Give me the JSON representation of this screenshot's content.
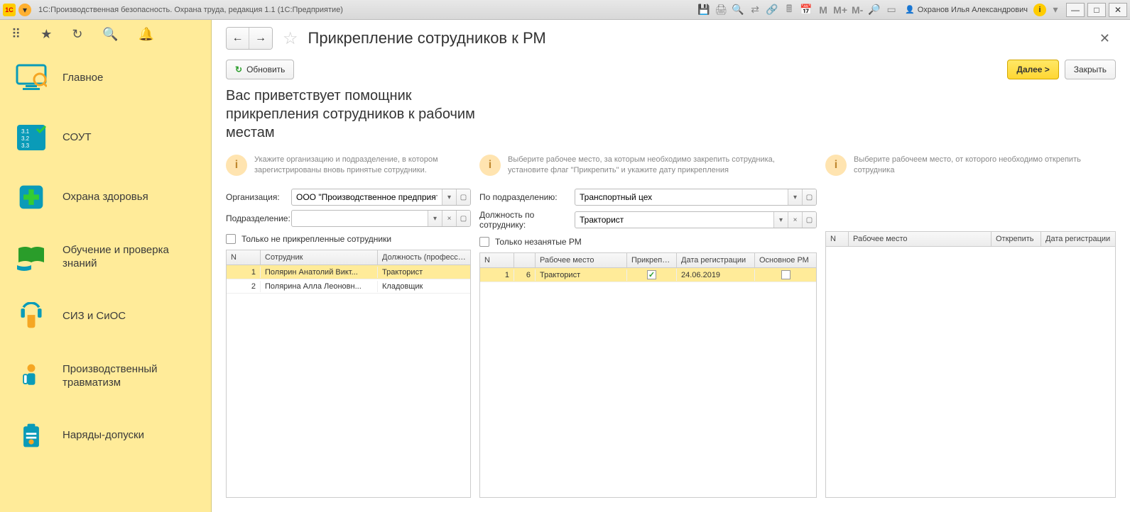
{
  "titlebar": {
    "title": "1С:Производственная безопасность. Охрана труда, редакция 1.1  (1С:Предприятие)",
    "user": "Охранов Илья Александрович"
  },
  "sidebar": {
    "items": [
      {
        "label": "Главное"
      },
      {
        "label": "СОУТ"
      },
      {
        "label": "Охрана здоровья"
      },
      {
        "label": "Обучение и проверка знаний"
      },
      {
        "label": "СИЗ и СиОС"
      },
      {
        "label": "Производственный травматизм"
      },
      {
        "label": "Наряды-допуски"
      }
    ]
  },
  "page": {
    "title": "Прикрепление сотрудников к РМ",
    "refresh": "Обновить",
    "next": "Далее >",
    "close": "Закрыть",
    "heading": "Вас приветствует помощник прикрепления сотрудников к рабочим местам"
  },
  "col1": {
    "hint": "Укажите организацию и подразделение, в котором зарегистрированы вновь принятые сотрудники.",
    "org_label": "Организация:",
    "org_value": "ООО \"Производственное предприятие\"",
    "dept_label": "Подразделение:",
    "dept_value": "",
    "checkbox_label": "Только не прикрепленные сотрудники",
    "headers": {
      "n": "N",
      "emp": "Сотрудник",
      "pos": "Должность (профессия)"
    },
    "rows": [
      {
        "n": "1",
        "emp": "Полярин Анатолий Викт...",
        "pos": "Тракторист",
        "selected": true
      },
      {
        "n": "2",
        "emp": "Полярина Алла Леоновн...",
        "pos": "Кладовщик",
        "selected": false
      }
    ]
  },
  "col2": {
    "hint": "Выберите рабочее место, за которым необходимо закрепить сотрудника, установите флаг \"Прикрепить\" и укажите дату прикрепления",
    "dept_label": "По подразделению:",
    "dept_value": "Транспортный цех",
    "pos_label": "Должность по сотруднику:",
    "pos_value": "Тракторист",
    "checkbox_label": "Только незанятые РМ",
    "headers": {
      "n": "N",
      "n2": "",
      "rm": "Рабочее место",
      "attach": "Прикрепить",
      "date": "Дата регистрации",
      "main": "Основное РМ"
    },
    "rows": [
      {
        "n": "1",
        "n2": "6",
        "rm": "Тракторист",
        "attach": true,
        "date": "24.06.2019",
        "main": false,
        "selected": true
      }
    ]
  },
  "col3": {
    "hint": "Выберите рабочеем место, от которого необходимо открепить сотрудника",
    "headers": {
      "n": "N",
      "rm": "Рабочее место",
      "detach": "Открепить",
      "date": "Дата регистрации"
    },
    "rows": []
  }
}
